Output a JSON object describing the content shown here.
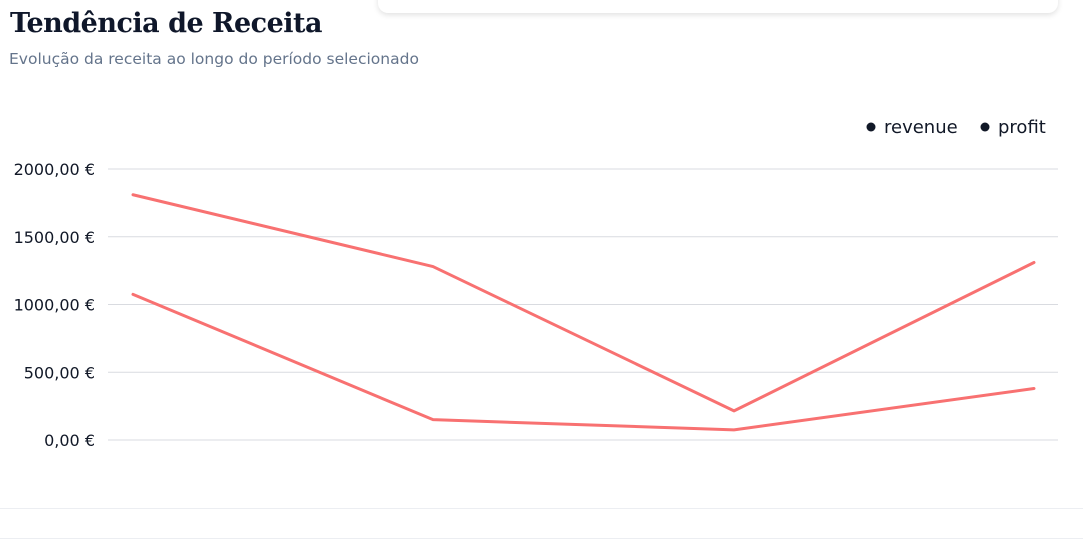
{
  "header": {
    "title": "Tendência de Receita",
    "subtitle": "Evolução da receita ao longo do período selecionado"
  },
  "colors": {
    "line": "#f87171",
    "grid": "#d9dbe0",
    "legend_dot": "#111827"
  },
  "chart_data": {
    "type": "line",
    "x": [
      "",
      "",
      "",
      ""
    ],
    "series": [
      {
        "name": "revenue",
        "values": [
          1810,
          1280,
          215,
          1310
        ]
      },
      {
        "name": "profit",
        "values": [
          1075,
          150,
          75,
          380
        ]
      }
    ],
    "yticks": [
      0,
      500,
      1000,
      1500,
      2000
    ],
    "ytick_labels": [
      "0,00 €",
      "500,00 €",
      "1000,00 €",
      "1500,00 €",
      "2000,00 €"
    ],
    "ylim": [
      0,
      2000
    ],
    "grid": true,
    "legend_position": "top-right"
  }
}
